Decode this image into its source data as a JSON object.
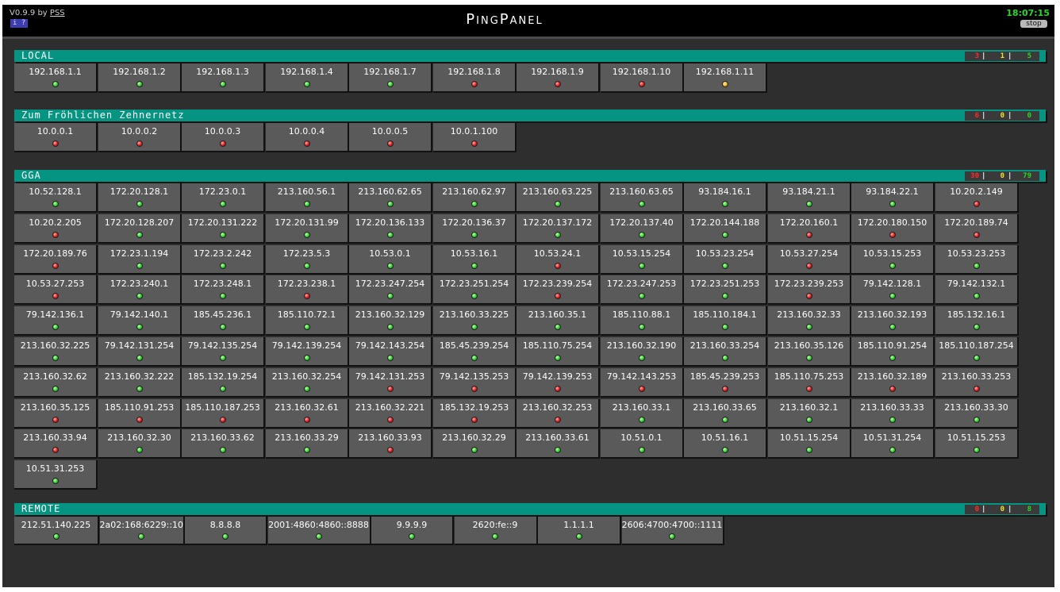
{
  "header": {
    "version": "V0.9.9 by ",
    "author": "PSS",
    "info_label": "i ?",
    "title": "PingPanel",
    "clock": "18:07:15",
    "stop_label": "stop"
  },
  "colors": {
    "ok": "#2ed12e",
    "fail": "#e21a1a",
    "warn": "#f2b419",
    "header": "#069482"
  },
  "groups": [
    {
      "name": "LOCAL",
      "counts": {
        "red": "3",
        "yellow": "1",
        "green": "5"
      },
      "hosts": [
        {
          "ip": "192.168.1.1",
          "status": "green"
        },
        {
          "ip": "192.168.1.2",
          "status": "green"
        },
        {
          "ip": "192.168.1.3",
          "status": "green"
        },
        {
          "ip": "192.168.1.4",
          "status": "green"
        },
        {
          "ip": "192.168.1.7",
          "status": "green"
        },
        {
          "ip": "192.168.1.8",
          "status": "red"
        },
        {
          "ip": "192.168.1.9",
          "status": "red"
        },
        {
          "ip": "192.168.1.10",
          "status": "red"
        },
        {
          "ip": "192.168.1.11",
          "status": "yellow"
        }
      ]
    },
    {
      "name": "Zum Fröhlichen Zehnernetz",
      "counts": {
        "red": "6",
        "yellow": "0",
        "green": "0"
      },
      "hosts": [
        {
          "ip": "10.0.0.1",
          "status": "red"
        },
        {
          "ip": "10.0.0.2",
          "status": "red"
        },
        {
          "ip": "10.0.0.3",
          "status": "red"
        },
        {
          "ip": "10.0.0.4",
          "status": "red"
        },
        {
          "ip": "10.0.0.5",
          "status": "red"
        },
        {
          "ip": "10.0.1.100",
          "status": "red"
        }
      ]
    },
    {
      "name": "GGA",
      "counts": {
        "red": "30",
        "yellow": "0",
        "green": "79"
      },
      "hosts": [
        {
          "ip": "10.52.128.1",
          "status": "green"
        },
        {
          "ip": "172.20.128.1",
          "status": "green"
        },
        {
          "ip": "172.23.0.1",
          "status": "green"
        },
        {
          "ip": "213.160.56.1",
          "status": "green"
        },
        {
          "ip": "213.160.62.65",
          "status": "green"
        },
        {
          "ip": "213.160.62.97",
          "status": "green"
        },
        {
          "ip": "213.160.63.225",
          "status": "green"
        },
        {
          "ip": "213.160.63.65",
          "status": "green"
        },
        {
          "ip": "93.184.16.1",
          "status": "green"
        },
        {
          "ip": "93.184.21.1",
          "status": "green"
        },
        {
          "ip": "93.184.22.1",
          "status": "green"
        },
        {
          "ip": "10.20.2.149",
          "status": "red"
        },
        {
          "ip": "10.20.2.205",
          "status": "red"
        },
        {
          "ip": "172.20.128.207",
          "status": "green"
        },
        {
          "ip": "172.20.131.222",
          "status": "green"
        },
        {
          "ip": "172.20.131.99",
          "status": "green"
        },
        {
          "ip": "172.20.136.133",
          "status": "green"
        },
        {
          "ip": "172.20.136.37",
          "status": "green"
        },
        {
          "ip": "172.20.137.172",
          "status": "green"
        },
        {
          "ip": "172.20.137.40",
          "status": "green"
        },
        {
          "ip": "172.20.144.188",
          "status": "green"
        },
        {
          "ip": "172.20.160.1",
          "status": "red"
        },
        {
          "ip": "172.20.180.150",
          "status": "red"
        },
        {
          "ip": "172.20.189.74",
          "status": "red"
        },
        {
          "ip": "172.20.189.76",
          "status": "red"
        },
        {
          "ip": "172.23.1.194",
          "status": "green"
        },
        {
          "ip": "172.23.2.242",
          "status": "green"
        },
        {
          "ip": "172.23.5.3",
          "status": "green"
        },
        {
          "ip": "10.53.0.1",
          "status": "green"
        },
        {
          "ip": "10.53.16.1",
          "status": "green"
        },
        {
          "ip": "10.53.24.1",
          "status": "red"
        },
        {
          "ip": "10.53.15.254",
          "status": "green"
        },
        {
          "ip": "10.53.23.254",
          "status": "green"
        },
        {
          "ip": "10.53.27.254",
          "status": "red"
        },
        {
          "ip": "10.53.15.253",
          "status": "green"
        },
        {
          "ip": "10.53.23.253",
          "status": "green"
        },
        {
          "ip": "10.53.27.253",
          "status": "red"
        },
        {
          "ip": "172.23.240.1",
          "status": "green"
        },
        {
          "ip": "172.23.248.1",
          "status": "green"
        },
        {
          "ip": "172.23.238.1",
          "status": "red"
        },
        {
          "ip": "172.23.247.254",
          "status": "green"
        },
        {
          "ip": "172.23.251.254",
          "status": "green"
        },
        {
          "ip": "172.23.239.254",
          "status": "red"
        },
        {
          "ip": "172.23.247.253",
          "status": "green"
        },
        {
          "ip": "172.23.251.253",
          "status": "green"
        },
        {
          "ip": "172.23.239.253",
          "status": "red"
        },
        {
          "ip": "79.142.128.1",
          "status": "green"
        },
        {
          "ip": "79.142.132.1",
          "status": "green"
        },
        {
          "ip": "79.142.136.1",
          "status": "green"
        },
        {
          "ip": "79.142.140.1",
          "status": "green"
        },
        {
          "ip": "185.45.236.1",
          "status": "green"
        },
        {
          "ip": "185.110.72.1",
          "status": "green"
        },
        {
          "ip": "213.160.32.129",
          "status": "green"
        },
        {
          "ip": "213.160.33.225",
          "status": "green"
        },
        {
          "ip": "213.160.35.1",
          "status": "green"
        },
        {
          "ip": "185.110.88.1",
          "status": "green"
        },
        {
          "ip": "185.110.184.1",
          "status": "green"
        },
        {
          "ip": "213.160.32.33",
          "status": "green"
        },
        {
          "ip": "213.160.32.193",
          "status": "green"
        },
        {
          "ip": "185.132.16.1",
          "status": "green"
        },
        {
          "ip": "213.160.32.225",
          "status": "green"
        },
        {
          "ip": "79.142.131.254",
          "status": "green"
        },
        {
          "ip": "79.142.135.254",
          "status": "green"
        },
        {
          "ip": "79.142.139.254",
          "status": "green"
        },
        {
          "ip": "79.142.143.254",
          "status": "green"
        },
        {
          "ip": "185.45.239.254",
          "status": "green"
        },
        {
          "ip": "185.110.75.254",
          "status": "green"
        },
        {
          "ip": "213.160.32.190",
          "status": "green"
        },
        {
          "ip": "213.160.33.254",
          "status": "green"
        },
        {
          "ip": "213.160.35.126",
          "status": "green"
        },
        {
          "ip": "185.110.91.254",
          "status": "green"
        },
        {
          "ip": "185.110.187.254",
          "status": "green"
        },
        {
          "ip": "213.160.32.62",
          "status": "green"
        },
        {
          "ip": "213.160.32.222",
          "status": "green"
        },
        {
          "ip": "185.132.19.254",
          "status": "green"
        },
        {
          "ip": "213.160.32.254",
          "status": "green"
        },
        {
          "ip": "79.142.131.253",
          "status": "red"
        },
        {
          "ip": "79.142.135.253",
          "status": "red"
        },
        {
          "ip": "79.142.139.253",
          "status": "red"
        },
        {
          "ip": "79.142.143.253",
          "status": "red"
        },
        {
          "ip": "185.45.239.253",
          "status": "red"
        },
        {
          "ip": "185.110.75.253",
          "status": "red"
        },
        {
          "ip": "213.160.32.189",
          "status": "red"
        },
        {
          "ip": "213.160.33.253",
          "status": "red"
        },
        {
          "ip": "213.160.35.125",
          "status": "red"
        },
        {
          "ip": "185.110.91.253",
          "status": "red"
        },
        {
          "ip": "185.110.187.253",
          "status": "red"
        },
        {
          "ip": "213.160.32.61",
          "status": "red"
        },
        {
          "ip": "213.160.32.221",
          "status": "red"
        },
        {
          "ip": "185.132.19.253",
          "status": "red"
        },
        {
          "ip": "213.160.32.253",
          "status": "red"
        },
        {
          "ip": "213.160.33.1",
          "status": "green"
        },
        {
          "ip": "213.160.33.65",
          "status": "green"
        },
        {
          "ip": "213.160.32.1",
          "status": "green"
        },
        {
          "ip": "213.160.33.33",
          "status": "green"
        },
        {
          "ip": "213.160.33.30",
          "status": "green"
        },
        {
          "ip": "213.160.33.94",
          "status": "red"
        },
        {
          "ip": "213.160.32.30",
          "status": "green"
        },
        {
          "ip": "213.160.33.62",
          "status": "green"
        },
        {
          "ip": "213.160.33.29",
          "status": "green"
        },
        {
          "ip": "213.160.33.93",
          "status": "red"
        },
        {
          "ip": "213.160.32.29",
          "status": "green"
        },
        {
          "ip": "213.160.33.61",
          "status": "green"
        },
        {
          "ip": "10.51.0.1",
          "status": "green"
        },
        {
          "ip": "10.51.16.1",
          "status": "green"
        },
        {
          "ip": "10.51.15.254",
          "status": "green"
        },
        {
          "ip": "10.51.31.254",
          "status": "green"
        },
        {
          "ip": "10.51.15.253",
          "status": "green"
        },
        {
          "ip": "10.51.31.253",
          "status": "green"
        }
      ]
    },
    {
      "name": "REMOTE",
      "counts": {
        "red": "0",
        "yellow": "0",
        "green": "8"
      },
      "hosts": [
        {
          "ip": "212.51.140.225",
          "status": "green"
        },
        {
          "ip": "2a02:168:6229::10",
          "status": "green"
        },
        {
          "ip": "8.8.8.8",
          "status": "green"
        },
        {
          "ip": "2001:4860:4860::8888",
          "status": "green"
        },
        {
          "ip": "9.9.9.9",
          "status": "green"
        },
        {
          "ip": "2620:fe::9",
          "status": "green"
        },
        {
          "ip": "1.1.1.1",
          "status": "green"
        },
        {
          "ip": "2606:4700:4700::1111",
          "status": "green"
        }
      ]
    }
  ]
}
